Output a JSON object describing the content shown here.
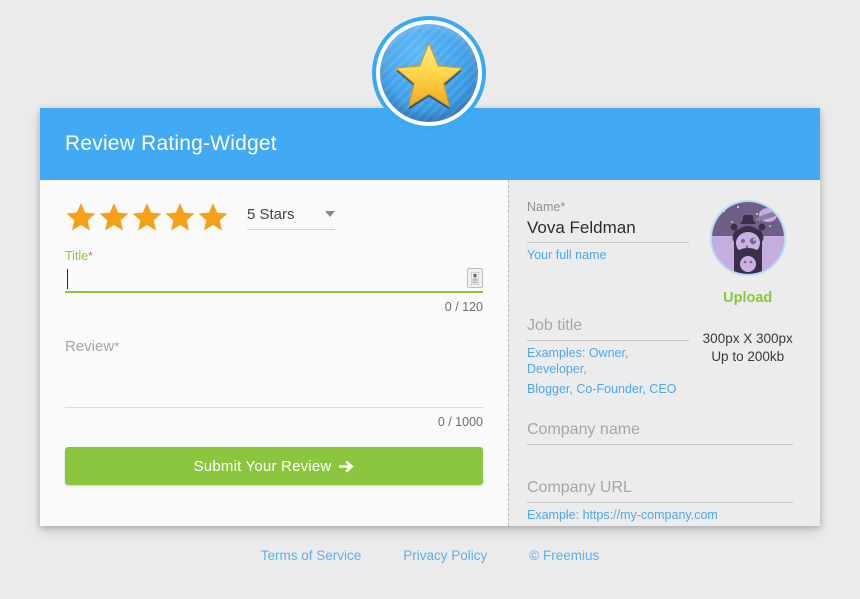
{
  "badge": {
    "icon": "star-badge-icon"
  },
  "card": {
    "header": {
      "title": "Review Rating-Widget"
    }
  },
  "rating": {
    "stars_filled": 5,
    "stars_total": 5,
    "selected_label": "5 Stars",
    "dropdown_icon": "chevron-down-icon"
  },
  "title_field": {
    "label": "Title",
    "required_mark": "*",
    "value": "",
    "counter": "0 / 120",
    "resize_icon": "resize-grip-icon"
  },
  "review_field": {
    "placeholder": "Review",
    "required_mark": "*",
    "value": "",
    "counter": "0 / 1000"
  },
  "submit": {
    "label": "Submit Your Review",
    "icon": "arrow-right-icon"
  },
  "name_field": {
    "label": "Name",
    "required_mark": "*",
    "value": "Vova Feldman",
    "hint": "Your full name"
  },
  "avatar": {
    "icon": "astronaut-avatar-icon",
    "upload_label": "Upload",
    "spec_line1": "300px X 300px",
    "spec_line2": "Up to 200kb"
  },
  "job_field": {
    "placeholder": "Job title",
    "hint_line1": "Examples: Owner, Developer,",
    "hint_line2": "Blogger, Co-Founder, CEO"
  },
  "company_field": {
    "placeholder": "Company name"
  },
  "url_field": {
    "placeholder": "Company URL",
    "hint": "Example: https://my-company.com"
  },
  "footer": {
    "terms": "Terms of Service",
    "privacy": "Privacy Policy",
    "copyright": "© Freemius"
  },
  "colors": {
    "header_blue": "#42aaf5",
    "accent_green": "#8cc63f",
    "star_orange": "#f5a016",
    "link_blue": "#51a7ea",
    "required_pink": "#e6578f"
  }
}
